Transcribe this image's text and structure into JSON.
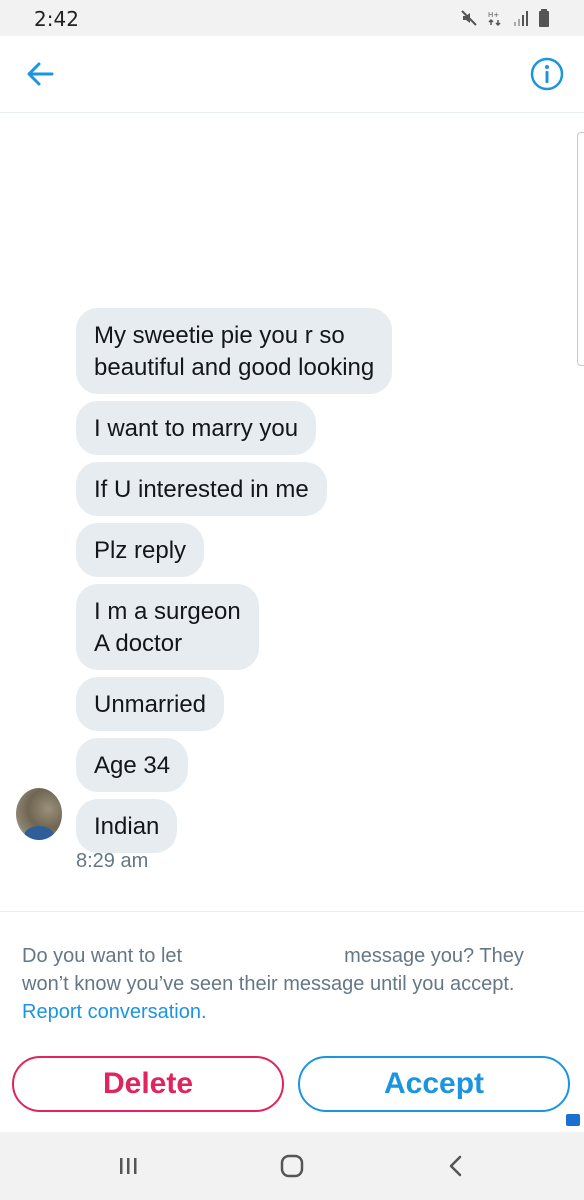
{
  "status_bar": {
    "time": "2:42"
  },
  "header": {
    "back_icon": "arrow-left-icon",
    "info_icon": "info-icon",
    "accent_color": "#1b95e0"
  },
  "messages": [
    {
      "text": "My sweetie pie you r so\nbeautiful and good looking"
    },
    {
      "text": "I want to  marry you"
    },
    {
      "text": "If U interested in me"
    },
    {
      "text": "Plz reply"
    },
    {
      "text": "I m a surgeon\nA doctor"
    },
    {
      "text": "Unmarried"
    },
    {
      "text": "Age 34"
    },
    {
      "text": "Indian"
    }
  ],
  "timestamp": "8:29 am",
  "request": {
    "prefix": "Do you want to let",
    "suffix": "message you? They won’t know you’ve seen their message until you accept.",
    "report_link": "Report conversation."
  },
  "actions": {
    "delete_label": "Delete",
    "accept_label": "Accept",
    "delete_color": "#e0245e",
    "accept_color": "#1b95e0"
  },
  "nav": {
    "recents_icon": "recents-icon",
    "home_icon": "home-icon",
    "back_icon": "back-chevron-icon"
  }
}
